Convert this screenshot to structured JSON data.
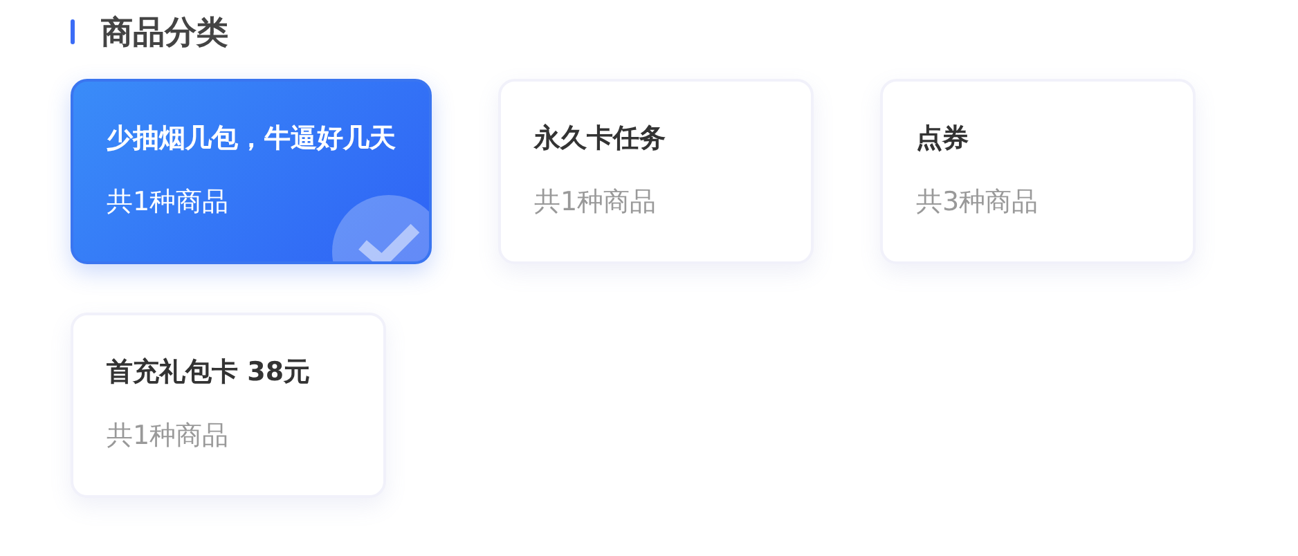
{
  "section": {
    "title": "商品分类"
  },
  "categories": [
    {
      "name": "少抽烟几包，牛逼好几天",
      "count": "共1种商品",
      "selected": true
    },
    {
      "name": "永久卡任务",
      "count": "共1种商品",
      "selected": false
    },
    {
      "name": "点券",
      "count": "共3种商品",
      "selected": false
    },
    {
      "name": "首充礼包卡 38元",
      "count": "共1种商品",
      "selected": false
    }
  ]
}
